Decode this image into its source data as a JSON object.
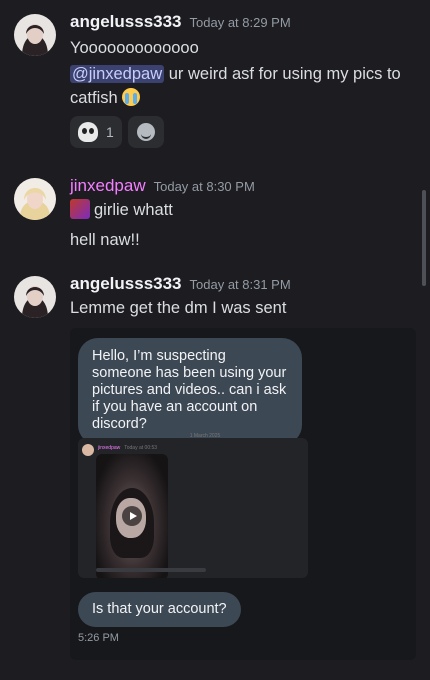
{
  "messages": [
    {
      "author": "angelusss333",
      "timestamp": "Today at 8:29 PM",
      "lines": {
        "line1": "Yooooooooooooo",
        "mention": "@jinxedpaw",
        "after_mention": " ur weird asf for using my pics to",
        "line3": "catfish "
      },
      "reactions": [
        {
          "icon": "ghost-emoji-icon",
          "count": "1"
        },
        {
          "icon": "add-reaction-icon",
          "count": ""
        }
      ]
    },
    {
      "author": "jinxedpaw",
      "timestamp": "Today at 8:30 PM",
      "lines": {
        "line1": "girlie whatt",
        "line2": "hell naw!!"
      }
    },
    {
      "author": "angelusss333",
      "timestamp": "Today at 8:31 PM",
      "lines": {
        "line1": "Lemme get the dm I was sent"
      },
      "attachment": {
        "bubble1": "Hello, I’m suspecting someone has been using your pictures and videos.. can i ask if you have an account on discord?",
        "date_divider": "1 March 2025",
        "inner_author": "jinxedpaw",
        "inner_timestamp": "Today at 00:53",
        "bubble2": "Is that your account?",
        "time": "5:26 PM"
      }
    }
  ],
  "colors": {
    "background": "#1c1c21",
    "mention_bg": "#3c4270",
    "username_pink": "#f47fff",
    "bubble": "#3d4855"
  }
}
